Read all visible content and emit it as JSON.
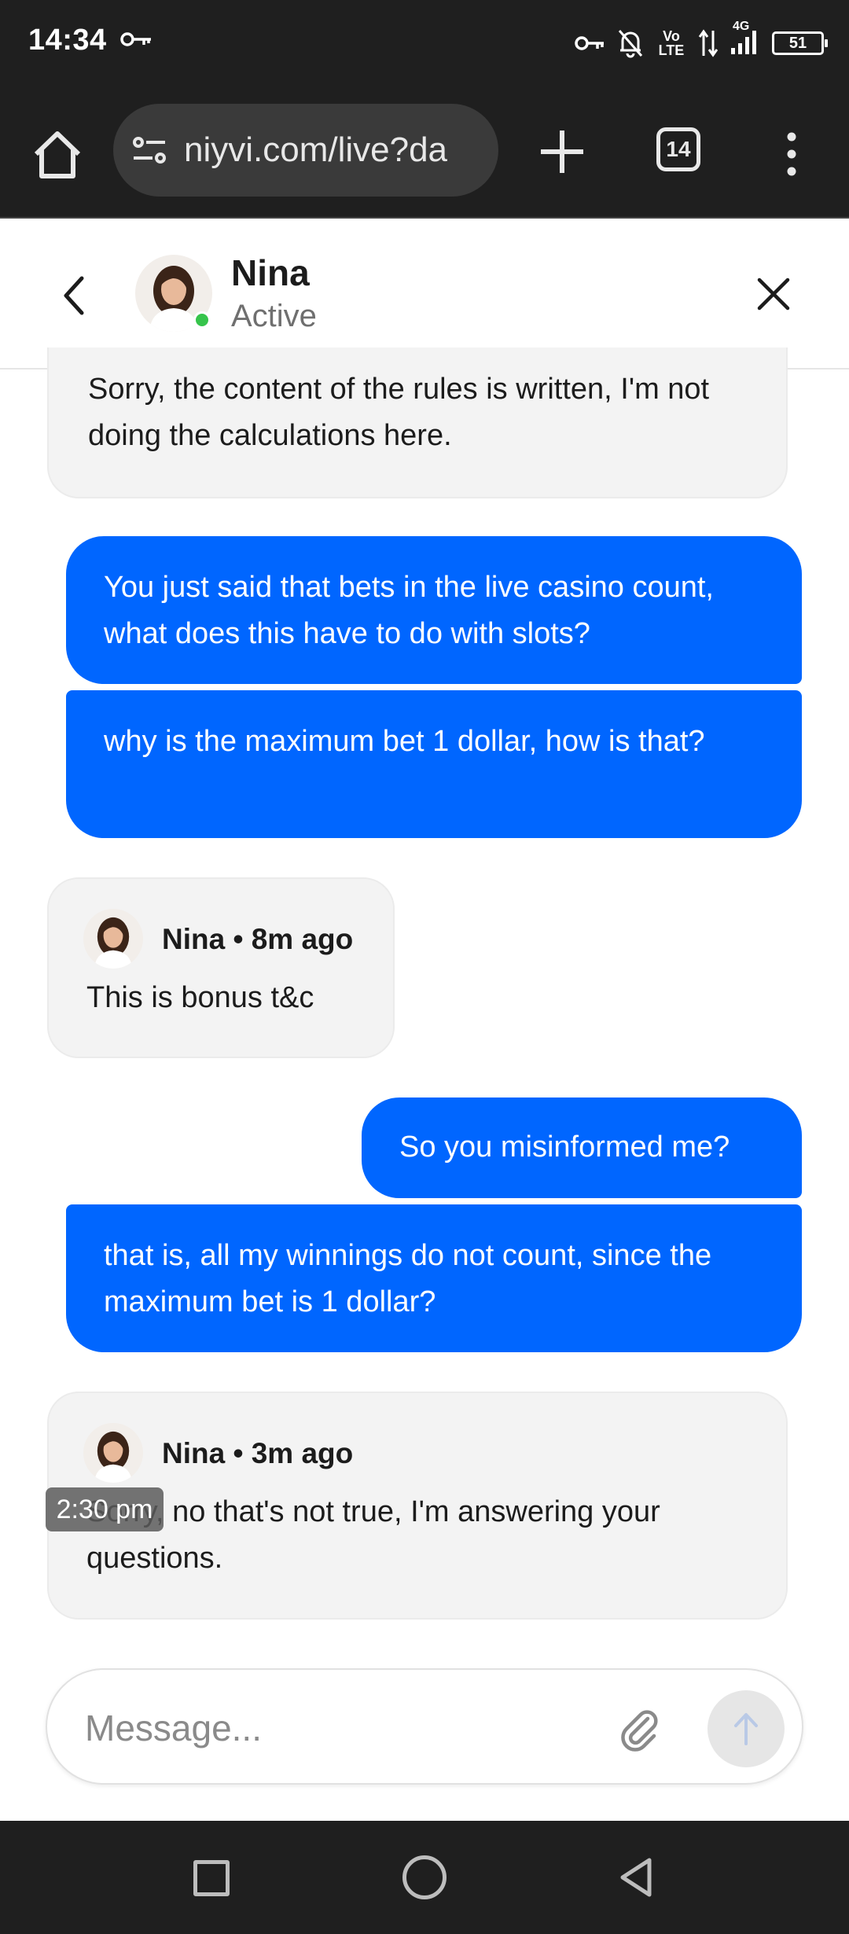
{
  "status_bar": {
    "time": "14:34",
    "volte_label": "Vo LTE",
    "network_label": "4G",
    "battery_level": "51"
  },
  "browser": {
    "url": "niyvi.com/live?da",
    "tab_count": "14"
  },
  "chat_header": {
    "agent_name": "Nina",
    "agent_status": "Active"
  },
  "messages": [
    {
      "direction": "incoming",
      "text": "Sorry, the content of the rules is written, I'm not doing the calculations here."
    },
    {
      "direction": "outgoing",
      "text": "You just said that bets in the live casino count, what does this have to do with slots?"
    },
    {
      "direction": "outgoing",
      "text": "why is the maximum bet 1 dollar, how is that?"
    },
    {
      "direction": "incoming",
      "meta": "Nina • 8m ago",
      "text": "This is bonus t&c"
    },
    {
      "direction": "outgoing",
      "text": "So you misinformed me?"
    },
    {
      "direction": "outgoing",
      "text": "that is, all my winnings do not count, since the maximum bet is 1 dollar?"
    },
    {
      "direction": "incoming",
      "meta": "Nina • 3m ago",
      "text": "Sorry, no that's not true, I'm answering your questions."
    }
  ],
  "timestamp_tooltip": "2:30 pm",
  "composer": {
    "placeholder": "Message..."
  },
  "colors": {
    "outgoing_bubble": "#0066ff",
    "incoming_bubble": "#f3f3f3",
    "online_indicator": "#36c44b",
    "system_bar": "#1f1f1f"
  },
  "icons": [
    "key-icon",
    "vpn-key-icon",
    "bell-off-icon",
    "data-arrows-icon",
    "signal-icon",
    "battery-icon",
    "home-icon",
    "site-settings-icon",
    "plus-icon",
    "tabs-icon",
    "more-vert-icon",
    "back-arrow-icon",
    "close-icon",
    "paperclip-icon",
    "send-arrow-icon",
    "nav-recents-icon",
    "nav-home-icon",
    "nav-back-icon"
  ]
}
